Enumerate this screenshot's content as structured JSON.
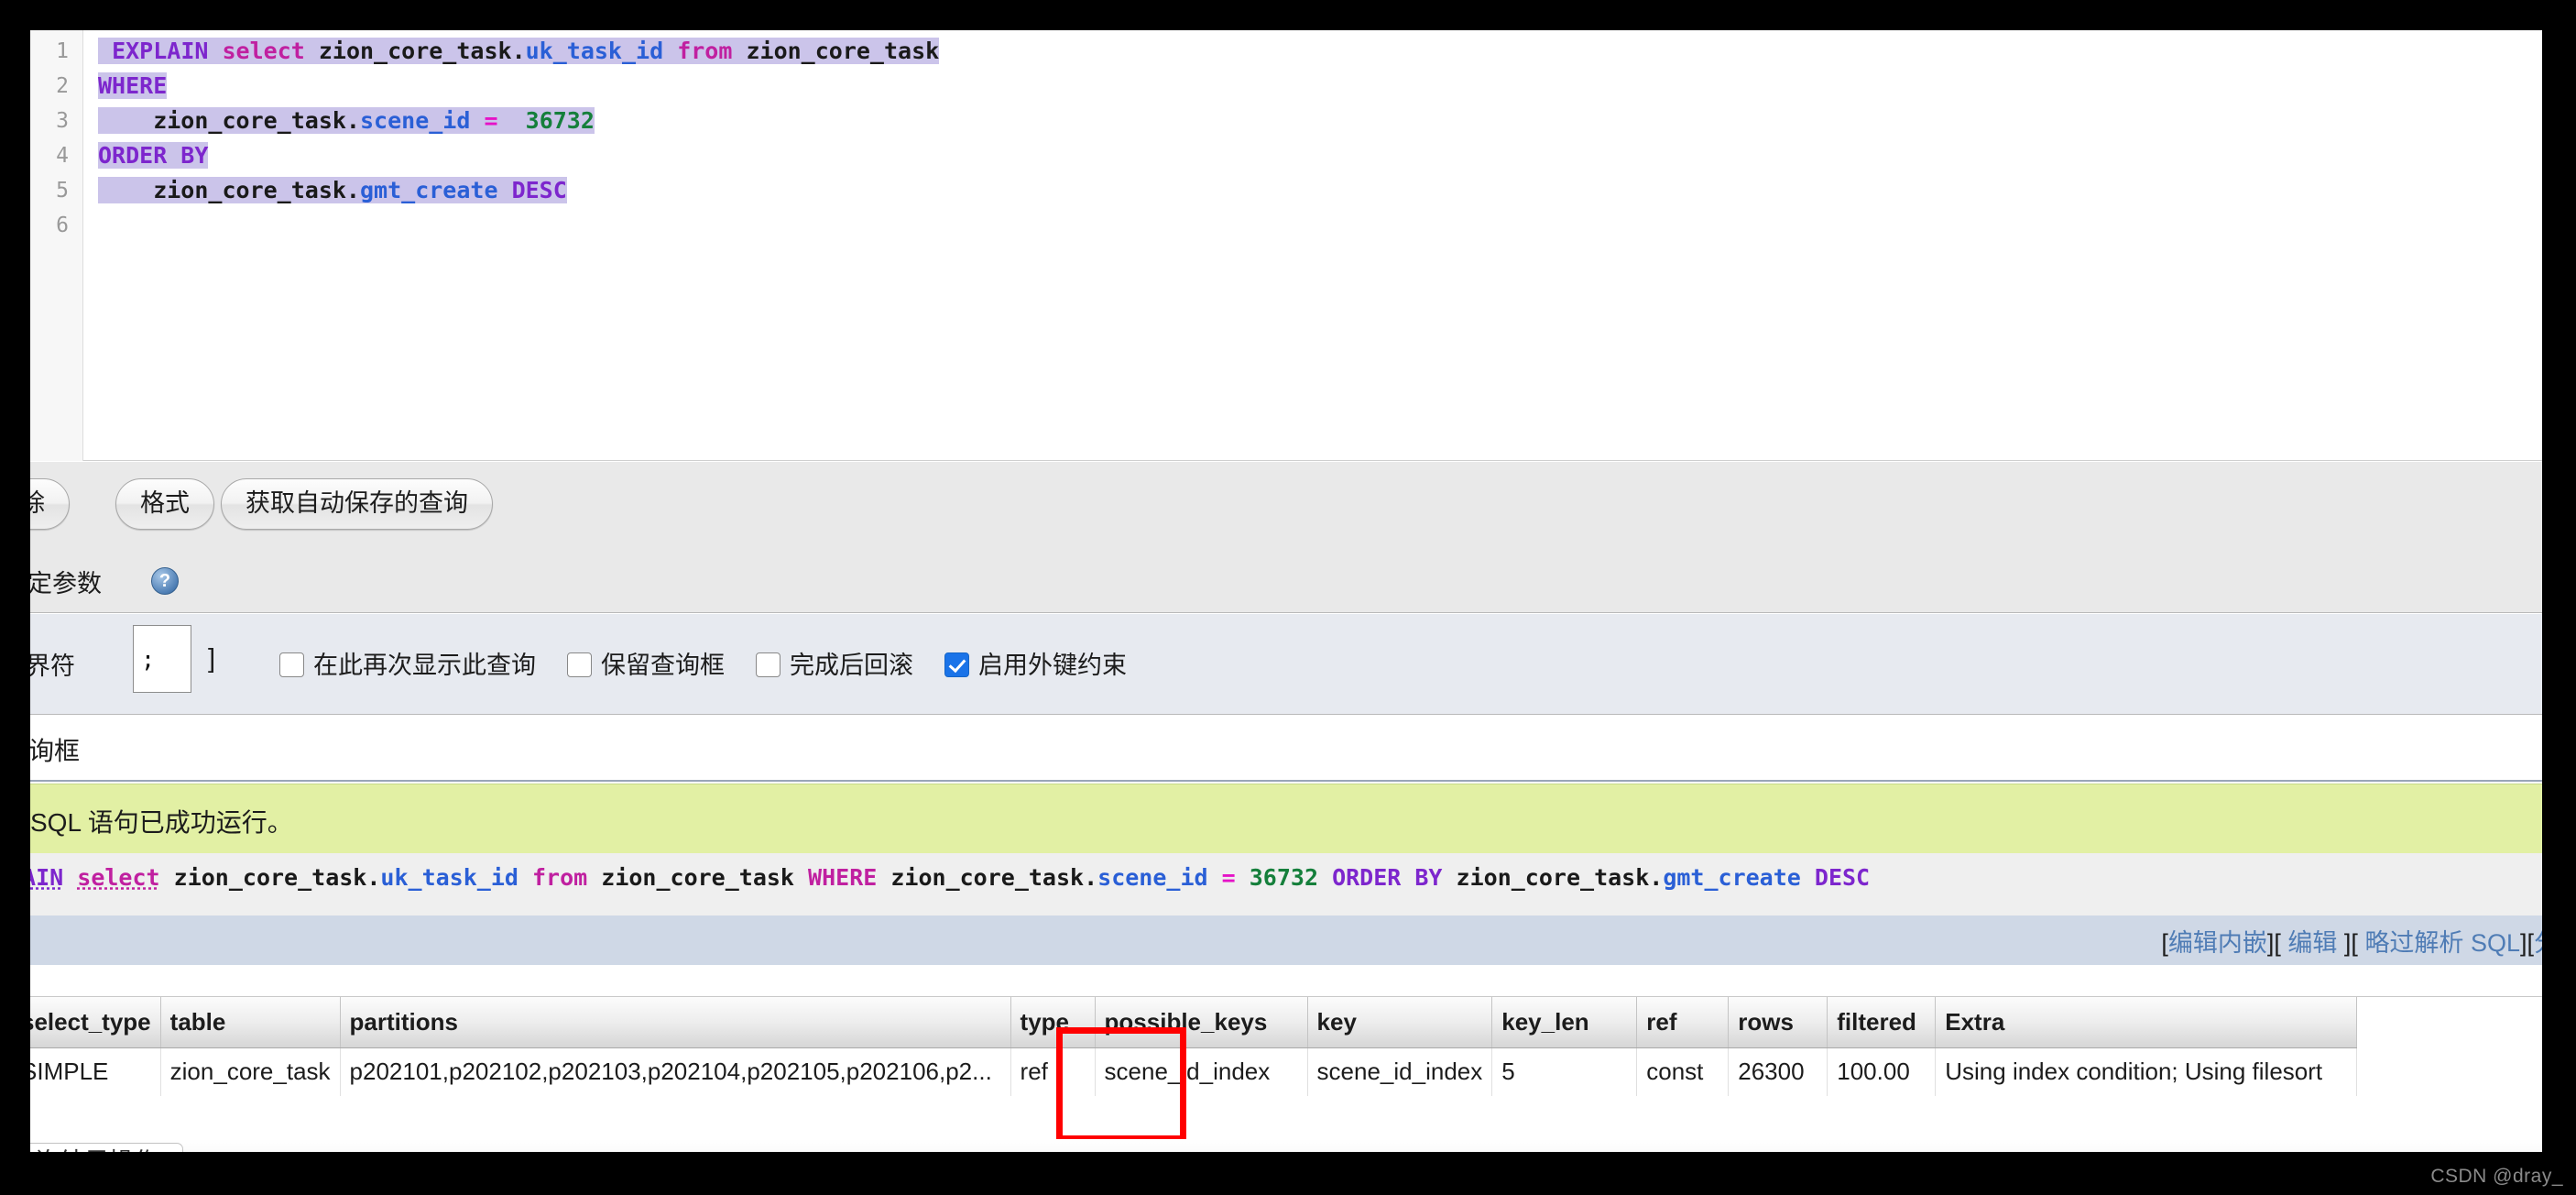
{
  "editor": {
    "line_numbers": [
      "1",
      "2",
      "3",
      "4",
      "5",
      "6"
    ],
    "lines": [
      {
        "n": "1",
        "tokens": [
          {
            "t": " ",
            "c": "tbl"
          },
          {
            "t": "EXPLAIN",
            "c": "kw"
          },
          {
            "t": " ",
            "c": "tbl"
          },
          {
            "t": "select",
            "c": "kw2"
          },
          {
            "t": " zion_core_task.",
            "c": "tbl"
          },
          {
            "t": "uk_task_id",
            "c": "col"
          },
          {
            "t": " ",
            "c": "tbl"
          },
          {
            "t": "from",
            "c": "kw2"
          },
          {
            "t": " zion_core_task",
            "c": "tbl"
          }
        ]
      },
      {
        "n": "2",
        "tokens": [
          {
            "t": "WHERE",
            "c": "kw"
          }
        ]
      },
      {
        "n": "3",
        "tokens": [
          {
            "t": "    zion_core_task.",
            "c": "tbl"
          },
          {
            "t": "scene_id",
            "c": "col"
          },
          {
            "t": " ",
            "c": "tbl"
          },
          {
            "t": "=",
            "c": "op"
          },
          {
            "t": "  ",
            "c": "tbl"
          },
          {
            "t": "36732",
            "c": "num"
          }
        ]
      },
      {
        "n": "4",
        "tokens": [
          {
            "t": "ORDER BY",
            "c": "kw"
          }
        ]
      },
      {
        "n": "5",
        "tokens": [
          {
            "t": "    zion_core_task.",
            "c": "tbl"
          },
          {
            "t": "gmt_create",
            "c": "col"
          },
          {
            "t": " ",
            "c": "tbl"
          },
          {
            "t": "DESC",
            "c": "kw"
          }
        ]
      },
      {
        "n": "6",
        "tokens": []
      }
    ],
    "plain_sql": "EXPLAIN select zion_core_task.uk_task_id from zion_core_task\nWHERE\n    zion_core_task.scene_id =  36732\nORDER BY\n    zion_core_task.gmt_create DESC"
  },
  "toolbar": {
    "clear_label": "除",
    "format_label": "格式",
    "autosave_label": "获取自动保存的查询"
  },
  "bind": {
    "label": "绑定参数",
    "help_icon": "help-icon",
    "help_glyph": "?"
  },
  "options": {
    "delimiter_label": "定界符",
    "delimiter_value": ";",
    "close_bracket": "]",
    "checkboxes": [
      {
        "label": "在此再次显示此查询",
        "checked": false
      },
      {
        "label": "保留查询框",
        "checked": false
      },
      {
        "label": "完成后回滚",
        "checked": false
      },
      {
        "label": "启用外键约束",
        "checked": true
      }
    ]
  },
  "querybox": {
    "title": "查询框"
  },
  "result": {
    "success_message": "SQL 语句已成功运行。",
    "echo_tokens": [
      {
        "t": "LAIN",
        "c": "kw uline"
      },
      {
        "t": " ",
        "c": "tbl"
      },
      {
        "t": "select",
        "c": "kw2 uline"
      },
      {
        "t": " zion_core_task.",
        "c": "tbl"
      },
      {
        "t": "uk_task_id",
        "c": "col"
      },
      {
        "t": " ",
        "c": "tbl"
      },
      {
        "t": "from",
        "c": "kw2"
      },
      {
        "t": " zion_core_task ",
        "c": "tbl"
      },
      {
        "t": "WHERE",
        "c": "kw2"
      },
      {
        "t": " zion_core_task.",
        "c": "tbl"
      },
      {
        "t": "scene_id",
        "c": "col"
      },
      {
        "t": " ",
        "c": "tbl"
      },
      {
        "t": "=",
        "c": "op"
      },
      {
        "t": " ",
        "c": "tbl"
      },
      {
        "t": "36732",
        "c": "num"
      },
      {
        "t": " ",
        "c": "tbl"
      },
      {
        "t": "ORDER BY",
        "c": "kw"
      },
      {
        "t": " zion_core_task.",
        "c": "tbl"
      },
      {
        "t": "gmt_create",
        "c": "col"
      },
      {
        "t": " ",
        "c": "tbl"
      },
      {
        "t": "DESC",
        "c": "kw"
      }
    ],
    "echo_plain": "LAIN select zion_core_task.uk_task_id from zion_core_task WHERE zion_core_task.scene_id = 36732 ORDER BY zion_core_task.gmt_create DESC",
    "links": [
      {
        "open": "[",
        "text": "编辑内嵌",
        "close": "]"
      },
      {
        "open": "[ ",
        "text": "编辑",
        "close": " ]"
      },
      {
        "open": "[ ",
        "text": "略过解析 SQL",
        "close": "]"
      },
      {
        "open": "[",
        "text": "分",
        "close": ""
      }
    ],
    "links_plain": "[编辑内嵌][ 编辑 ][ 略过解析 SQL][分"
  },
  "explain_table": {
    "columns": [
      "select_type",
      "table",
      "partitions",
      "type",
      "possible_keys",
      "key",
      "key_len",
      "ref",
      "rows",
      "filtered",
      "Extra"
    ],
    "rows": [
      {
        "select_type": "SIMPLE",
        "table": "zion_core_task",
        "partitions": "p202101,p202102,p202103,p202104,p202105,p202106,p2...",
        "type": "ref",
        "possible_keys": "scene_id_index",
        "key": "scene_id_index",
        "key_len": "5",
        "ref": "const",
        "rows": "26300",
        "filtered": "100.00",
        "Extra": "Using index condition; Using filesort"
      }
    ],
    "highlight_column": "type",
    "highlight_color": "#ff0000"
  },
  "bottom": {
    "tab_label": "询结果操作"
  },
  "watermark": "CSDN @dray_",
  "colors": {
    "selection": "#cbc4ea",
    "success_bg": "#e2f0a4",
    "link_bar_bg": "#cfd8e6",
    "keyword": "#7d26cd",
    "keyword2": "#c020a0",
    "column": "#2a5fd6",
    "number": "#157f3b",
    "operator": "#e513c7",
    "checkbox_accent": "#1a73e8"
  }
}
